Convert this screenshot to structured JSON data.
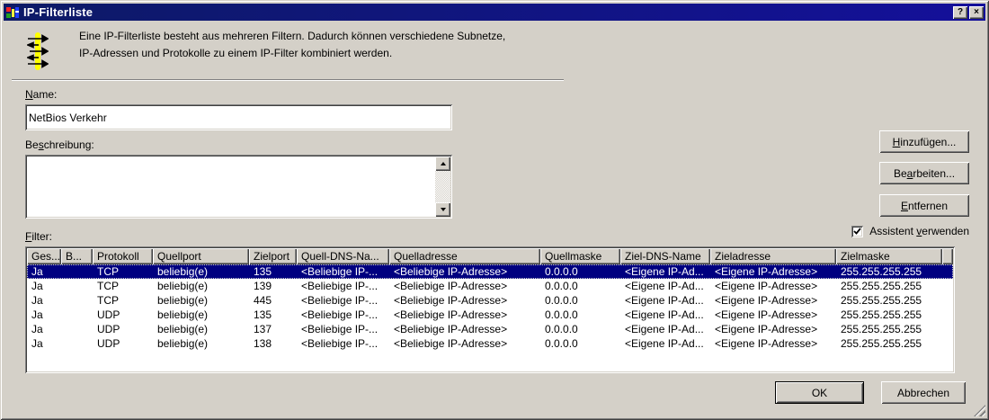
{
  "window": {
    "title": "IP-Filterliste",
    "help_glyph": "?",
    "close_glyph": "×"
  },
  "colors": {
    "dialog_bg": "#d4d0c8",
    "titlebar_left": "#0d1a66",
    "titlebar_right": "#14109a",
    "selection_bg": "#000080"
  },
  "intro": {
    "line1": "Eine IP-Filterliste besteht aus mehreren Filtern. Dadurch können  verschiedene Subnetze,",
    "line2": "IP-Adressen und Protokolle zu einem IP-Filter kombiniert werden."
  },
  "name_field": {
    "label": {
      "pre": "",
      "key": "N",
      "post": "ame:"
    },
    "value": "NetBios Verkehr"
  },
  "description_field": {
    "label": {
      "pre": "Be",
      "key": "s",
      "post": "chreibung:"
    },
    "value": ""
  },
  "buttons": {
    "add": {
      "pre": "",
      "key": "H",
      "post": "inzufügen..."
    },
    "edit": {
      "pre": "Be",
      "key": "a",
      "post": "rbeiten..."
    },
    "remove": {
      "pre": "",
      "key": "E",
      "post": "ntfernen"
    },
    "ok": "OK",
    "cancel": "Abbrechen"
  },
  "wizard_checkbox": {
    "label": {
      "pre": "Assistent ",
      "key": "v",
      "post": "erwenden"
    },
    "checked": true
  },
  "filter_section": {
    "label": {
      "pre": "",
      "key": "F",
      "post": "ilter:"
    }
  },
  "table": {
    "columns": [
      "Ges...",
      "B...",
      "Protokoll",
      "Quellport",
      "Zielport",
      "Quell-DNS-Na...",
      "Quelladresse",
      "Quellmaske",
      "Ziel-DNS-Name",
      "Zieladresse",
      "Zielmaske"
    ],
    "selected_row": 0,
    "rows": [
      [
        "Ja",
        "",
        "TCP",
        "beliebig(e)",
        "135",
        "<Beliebige IP-...",
        "<Beliebige IP-Adresse>",
        "0.0.0.0",
        "<Eigene IP-Ad...",
        "<Eigene IP-Adresse>",
        "255.255.255.255"
      ],
      [
        "Ja",
        "",
        "TCP",
        "beliebig(e)",
        "139",
        "<Beliebige IP-...",
        "<Beliebige IP-Adresse>",
        "0.0.0.0",
        "<Eigene IP-Ad...",
        "<Eigene IP-Adresse>",
        "255.255.255.255"
      ],
      [
        "Ja",
        "",
        "TCP",
        "beliebig(e)",
        "445",
        "<Beliebige IP-...",
        "<Beliebige IP-Adresse>",
        "0.0.0.0",
        "<Eigene IP-Ad...",
        "<Eigene IP-Adresse>",
        "255.255.255.255"
      ],
      [
        "Ja",
        "",
        "UDP",
        "beliebig(e)",
        "135",
        "<Beliebige IP-...",
        "<Beliebige IP-Adresse>",
        "0.0.0.0",
        "<Eigene IP-Ad...",
        "<Eigene IP-Adresse>",
        "255.255.255.255"
      ],
      [
        "Ja",
        "",
        "UDP",
        "beliebig(e)",
        "137",
        "<Beliebige IP-...",
        "<Beliebige IP-Adresse>",
        "0.0.0.0",
        "<Eigene IP-Ad...",
        "<Eigene IP-Adresse>",
        "255.255.255.255"
      ],
      [
        "Ja",
        "",
        "UDP",
        "beliebig(e)",
        "138",
        "<Beliebige IP-...",
        "<Beliebige IP-Adresse>",
        "0.0.0.0",
        "<Eigene IP-Ad...",
        "<Eigene IP-Adresse>",
        "255.255.255.255"
      ]
    ]
  }
}
